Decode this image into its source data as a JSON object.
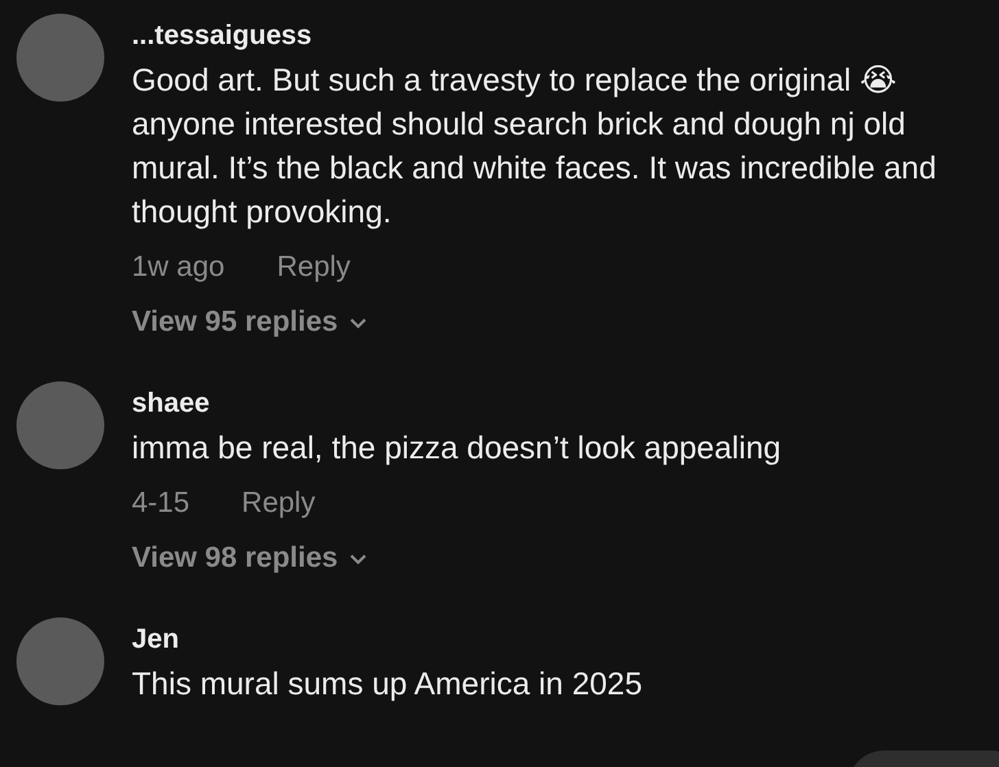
{
  "comments": [
    {
      "username": "...tessaiguess",
      "text": "Good art. But such a travesty to replace the original 😭 anyone interested should search brick and dough nj old mural. It’s the black and white faces. It was incredible and thought provoking.",
      "time": "1w ago",
      "reply": "Reply",
      "view_replies": "View 95 replies"
    },
    {
      "username": "shaee",
      "text": "imma be real, the pizza doesn’t look appealing",
      "time": "4-15",
      "reply": "Reply",
      "view_replies": "View 98 replies"
    },
    {
      "username": "Jen",
      "text": "This mural sums up America in 2025"
    }
  ]
}
